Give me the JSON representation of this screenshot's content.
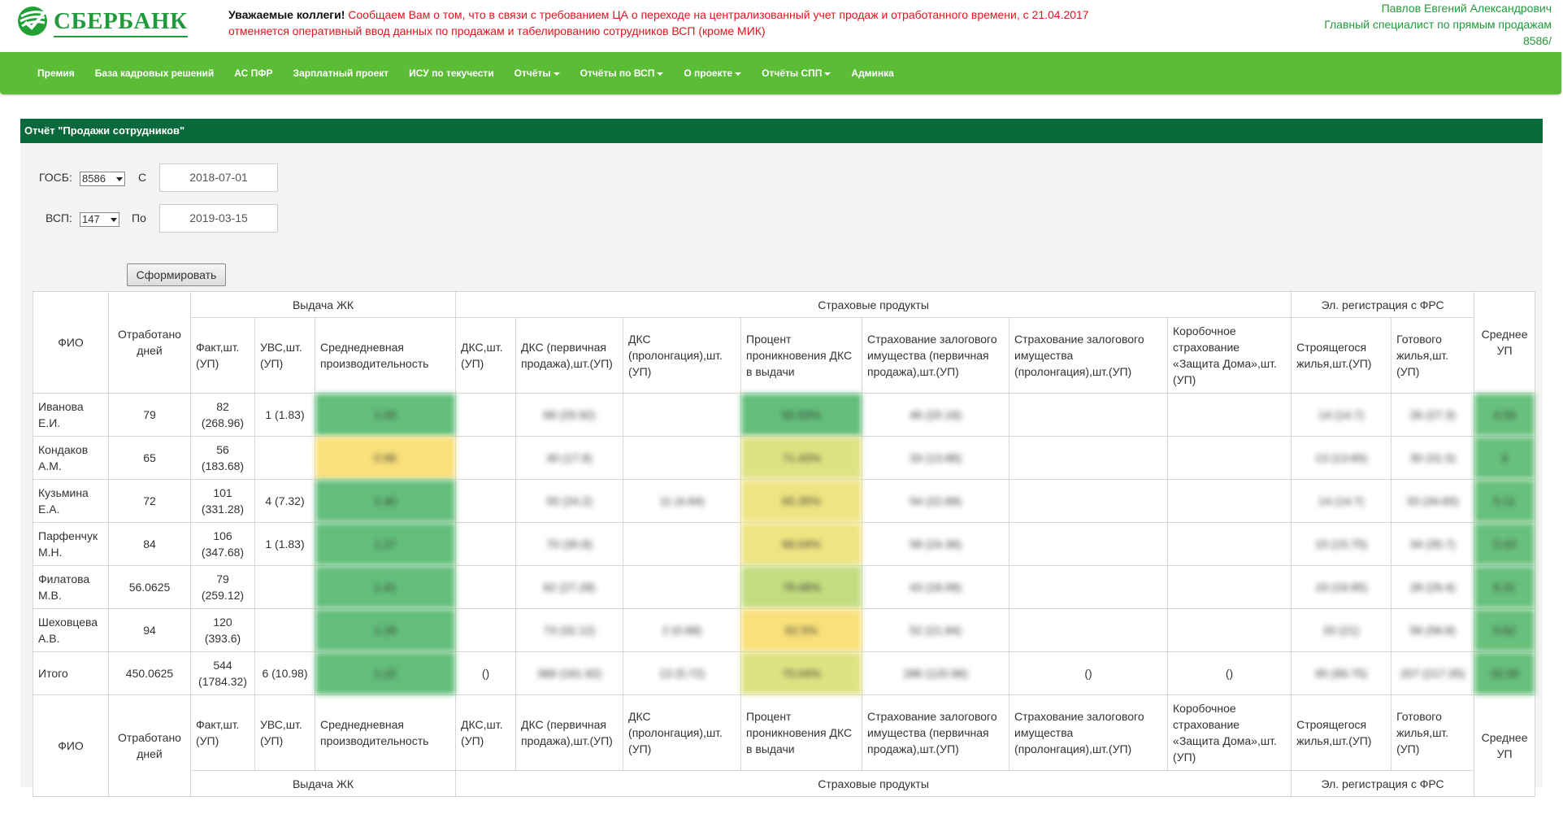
{
  "brand": {
    "name": "СБЕРБАНК"
  },
  "notice": {
    "bold": "Уважаемые коллеги!",
    "line1": " Сообщаем Вам о том, что в связи с требованием ЦА о переходе на централизованный учет продаж и отработанного времени, с 21.04.2017",
    "line2": "отменяется оперативный ввод данных по продажам и табелированию сотрудников ВСП (кроме МИК)"
  },
  "user": {
    "name": "Павлов Евгений Александрович",
    "position": "Главный специалист по прямым продажам",
    "unit": "8586/"
  },
  "nav": [
    {
      "label": "Премия",
      "dropdown": false
    },
    {
      "label": "База кадровых решений",
      "dropdown": false
    },
    {
      "label": "АС ПФР",
      "dropdown": false
    },
    {
      "label": "Зарплатный проект",
      "dropdown": false
    },
    {
      "label": "ИСУ по текучести",
      "dropdown": false
    },
    {
      "label": "Отчёты",
      "dropdown": true
    },
    {
      "label": "Отчёты по ВСП",
      "dropdown": true
    },
    {
      "label": "О проекте",
      "dropdown": true
    },
    {
      "label": "Отчёты СПП",
      "dropdown": true
    },
    {
      "label": "Админка",
      "dropdown": false
    }
  ],
  "report": {
    "title": "Отчёт \"Продажи сотрудников\"",
    "form": {
      "gosb_label": "ГОСБ:",
      "gosb_value": "8586",
      "vsp_label": "ВСП:",
      "vsp_value": "147",
      "from_label": "С",
      "from_value": "2018-07-01",
      "to_label": "По",
      "to_value": "2019-03-15",
      "submit_label": "Сформировать"
    },
    "groups": {
      "zhk": "Выдача ЖК",
      "ins": "Страховые продукты",
      "frs": "Эл. регистрация с ФРС"
    },
    "columns": {
      "fio": "ФИО",
      "days": "Отработано дней",
      "fact": "Факт,шт.(УП)",
      "uvs": "УВС,шт.(УП)",
      "avg_daily": "Среднедневная производительность",
      "dks": "ДКС,шт.(УП)",
      "dks_primary": "ДКС (первичная продажа),шт.(УП)",
      "dks_prolong": "ДКС (пролонгация),шт.(УП)",
      "dks_pct": "Процент проникновения ДКС в выдачи",
      "collat_primary": "Страхование залогового имущества (первичная продажа),шт.(УП)",
      "collat_prolong": "Страхование залогового имущества (пролонгация),шт.(УП)",
      "box": "Коробочное страхование «Защита Дома»,шт.(УП)",
      "building": "Строящегося жилья,шт.(УП)",
      "ready": "Готового жилья,шт.(УП)",
      "avg_up": "Среднее УП"
    },
    "rows": [
      {
        "fio": "Иванова Е.И.",
        "days": "79",
        "fact": "82 (268.96)",
        "uvs": "1 (1.83)",
        "avg": "1.05",
        "dks": "",
        "dks_p": "68 (29.92)",
        "dks_pr": "",
        "pct": "82.93%",
        "col_p": "46 (20.16)",
        "col_pr": "",
        "box": "",
        "bld": "14 (14.7)",
        "rdy": "26 (27.3)",
        "up": "4.59",
        "avg_cls": "g1",
        "pct_cls": "g1",
        "up_cls": "g2"
      },
      {
        "fio": "Кондаков А.М.",
        "days": "65",
        "fact": "56 (183.68)",
        "uvs": "",
        "avg": "0.86",
        "dks": "",
        "dks_p": "40 (17.6)",
        "dks_pr": "",
        "pct": "71.43%",
        "col_p": "33 (13.86)",
        "col_pr": "",
        "box": "",
        "bld": "13 (13.65)",
        "rdy": "30 (31.5)",
        "up": "4",
        "avg_cls": "y1",
        "pct_cls": "y4",
        "up_cls": "g2"
      },
      {
        "fio": "Кузьмина Е.А.",
        "days": "72",
        "fact": "101 (331.28)",
        "uvs": "4 (7.32)",
        "avg": "1.40",
        "dks": "",
        "dks_p": "55 (24.2)",
        "dks_pr": "11 (4.84)",
        "pct": "65.35%",
        "col_p": "54 (22.68)",
        "col_pr": "",
        "box": "",
        "bld": "14 (14.7)",
        "rdy": "33 (34.65)",
        "up": "5.11",
        "avg_cls": "g1",
        "pct_cls": "y2",
        "up_cls": "g2"
      },
      {
        "fio": "Парфенчук М.Н.",
        "days": "84",
        "fact": "106 (347.68)",
        "uvs": "1 (1.83)",
        "avg": "1.27",
        "dks": "",
        "dks_p": "70 (30.8)",
        "dks_pr": "",
        "pct": "66.04%",
        "col_p": "58 (24.36)",
        "col_pr": "",
        "box": "",
        "bld": "15 (15.75)",
        "rdy": "34 (35.7)",
        "up": "5.43",
        "avg_cls": "g1",
        "pct_cls": "y2",
        "up_cls": "g2"
      },
      {
        "fio": "Филатова М.В.",
        "days": "56.0625",
        "fact": "79 (259.12)",
        "uvs": "",
        "avg": "1.41",
        "dks": "",
        "dks_p": "62 (27.28)",
        "dks_pr": "",
        "pct": "78.48%",
        "col_p": "43 (18.06)",
        "col_pr": "",
        "box": "",
        "bld": "19 (19.95)",
        "rdy": "28 (29.4)",
        "up": "6.31",
        "avg_cls": "g1",
        "pct_cls": "y3",
        "up_cls": "g2"
      },
      {
        "fio": "Шеховцева А.В.",
        "days": "94",
        "fact": "120 (393.6)",
        "uvs": "",
        "avg": "1.28",
        "dks": "",
        "dks_p": "73 (32.12)",
        "dks_pr": "2 (0.88)",
        "pct": "62.5%",
        "col_p": "52 (21.84)",
        "col_pr": "",
        "box": "",
        "bld": "20 (21)",
        "rdy": "56 (58.8)",
        "up": "5.62",
        "avg_cls": "g1",
        "pct_cls": "y1",
        "up_cls": "g2"
      }
    ],
    "total": {
      "fio": "Итого",
      "days": "450.0625",
      "fact": "544 (1784.32)",
      "uvs": "6 (10.98)",
      "avg": "1.22",
      "dks": "()",
      "dks_p": "368 (161.92)",
      "dks_pr": "13 (5.72)",
      "pct": "70.04%",
      "col_p": "286 (120.96)",
      "col_pr": "()",
      "box": "()",
      "bld": "95 (99.75)",
      "rdy": "207 (217.35)",
      "up": "32.06",
      "avg_cls": "g1",
      "pct_cls": "y4",
      "up_cls": "g2"
    }
  }
}
